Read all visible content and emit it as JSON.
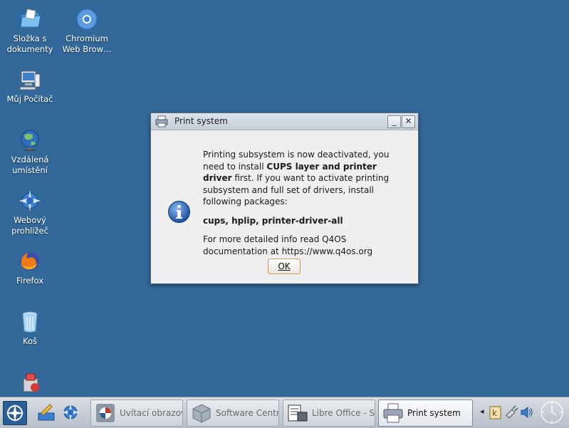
{
  "desktop": {
    "icons": [
      {
        "label": "Složka s dokumenty",
        "icon": "folder-icon"
      },
      {
        "label": "Chromium Web Brow…",
        "icon": "chromium-icon"
      },
      {
        "label": "Můj Počítač",
        "icon": "computer-icon"
      },
      {
        "label": "Vzdálená umístění",
        "icon": "network-globe-icon"
      },
      {
        "label": "Webový prohlížeč",
        "icon": "web-browser-icon"
      },
      {
        "label": "Firefox",
        "icon": "firefox-icon"
      },
      {
        "label": "Koš",
        "icon": "trash-icon"
      }
    ]
  },
  "dialog": {
    "title": "Print system",
    "msg_intro_1": "Printing subsystem is now deactivated, you need to install ",
    "msg_bold": "CUPS layer and printer driver",
    "msg_intro_2": " first. If you want to activate printing subsystem and full set of drivers, install following packages:",
    "packages": "cups, hplip, printer-driver-all",
    "more_info": "For more detailed info read Q4OS documentation at https://www.q4os.org",
    "ok_label": "OK",
    "minimize_label": "_",
    "close_label": "✕"
  },
  "taskbar": {
    "tasks": [
      {
        "label": "Uvítací obrazovk",
        "icon": "welcome-screen-icon",
        "active": false
      },
      {
        "label": "Software Centre",
        "icon": "software-centre-icon",
        "active": false
      },
      {
        "label": "Libre Office - Set",
        "icon": "libreoffice-setup-icon",
        "active": false
      },
      {
        "label": "Print system",
        "icon": "printer-icon",
        "active": true
      }
    ],
    "tray_arrow": "◂"
  },
  "colors": {
    "desktop": "#33699a",
    "accent": "#2a5f95",
    "ok_border": "#c59a5a"
  }
}
